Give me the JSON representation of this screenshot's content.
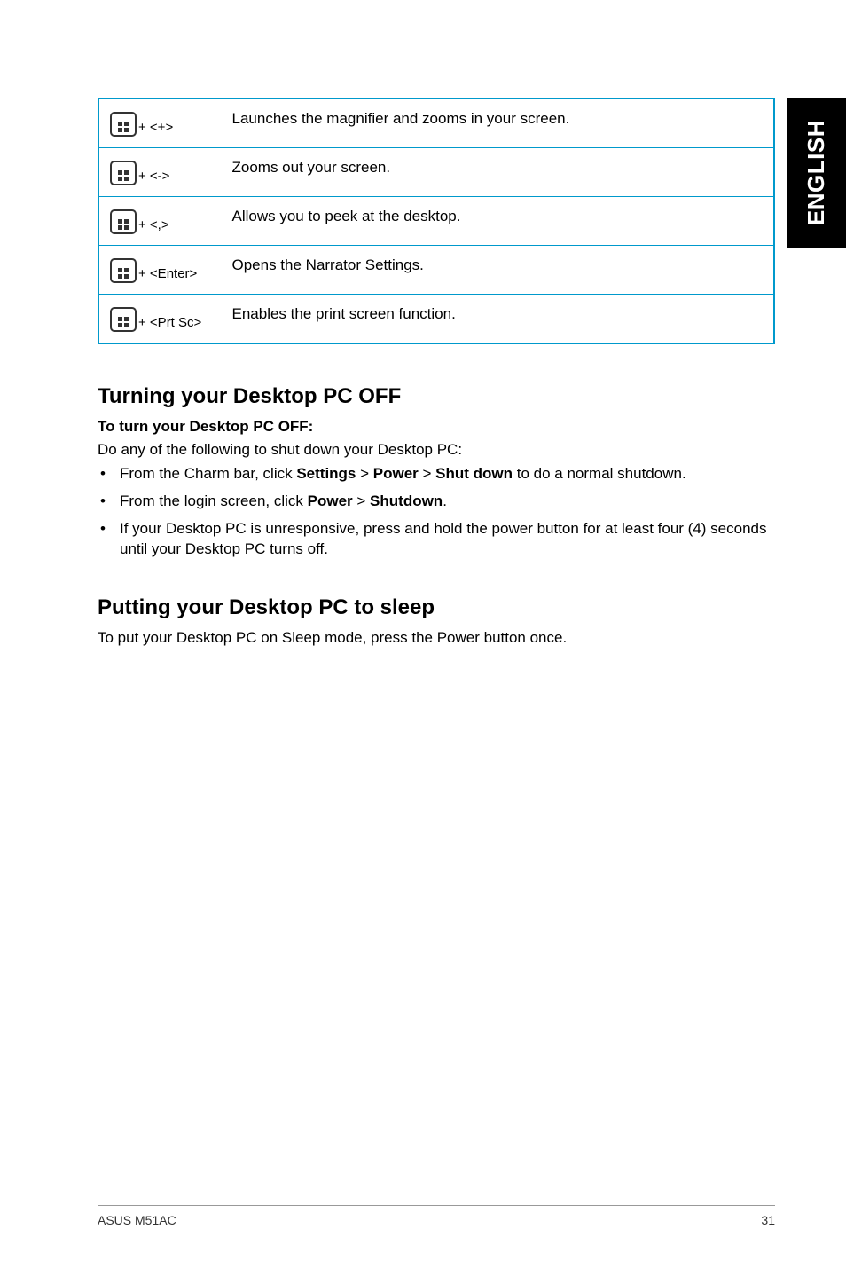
{
  "sideTab": "ENGLISH",
  "shortcuts": [
    {
      "key": "+ <+>",
      "description": "Launches the magnifier and zooms in your screen."
    },
    {
      "key": "+ <->",
      "description": "Zooms out your screen."
    },
    {
      "key": "+ <,>",
      "description": "Allows you to peek at the desktop."
    },
    {
      "key": "+ <Enter>",
      "description": "Opens the Narrator Settings."
    },
    {
      "key": "+ <Prt Sc>",
      "description": "Enables the print screen function."
    }
  ],
  "section1": {
    "heading": "Turning your Desktop PC OFF",
    "subheading": "To turn your Desktop PC OFF:",
    "intro": "Do any of the following to shut down your Desktop PC:",
    "bullets": [
      {
        "prefix": "From the Charm bar, click ",
        "bold1": "Settings",
        "mid1": " > ",
        "bold2": "Power",
        "mid2": " > ",
        "bold3": "Shut down",
        "suffix": " to do a normal shutdown."
      },
      {
        "prefix": "From the login screen, click ",
        "bold1": "Power",
        "mid1": " > ",
        "bold2": "Shutdown",
        "suffix": "."
      },
      {
        "plain": "If your Desktop PC is unresponsive, press and hold the power  button for at least four (4) seconds until your Desktop PC turns off."
      }
    ]
  },
  "section2": {
    "heading": "Putting your Desktop PC to sleep",
    "body": "To put your Desktop PC on Sleep mode, press the Power button once."
  },
  "footer": {
    "left": "ASUS M51AC",
    "right": "31"
  }
}
